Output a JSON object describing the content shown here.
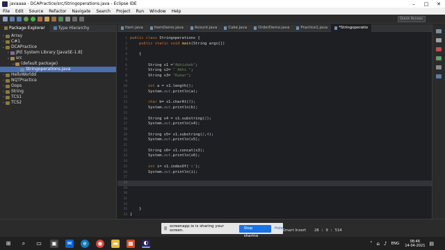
{
  "window": {
    "title": "javaaaa - DCAPractice/src/Stringoperations.java - Eclipse IDE"
  },
  "menu": [
    "File",
    "Edit",
    "Source",
    "Refactor",
    "Navigate",
    "Search",
    "Project",
    "Run",
    "Window",
    "Help"
  ],
  "quick_access": {
    "placeholder": "Quick Access"
  },
  "left_panel": {
    "tabs": [
      "Package Explorer",
      "Type Hierarchy"
    ],
    "tree": [
      {
        "label": "Array",
        "arrow": "›",
        "indent": 0,
        "icon": "project-icon"
      },
      {
        "label": "C#1",
        "arrow": "›",
        "indent": 0,
        "icon": "project-icon"
      },
      {
        "label": "DCAPractice",
        "arrow": "⌄",
        "indent": 0,
        "icon": "project-icon"
      },
      {
        "label": "JRE System Library [JavaSE-1.8]",
        "arrow": "›",
        "indent": 1,
        "icon": "library-icon"
      },
      {
        "label": "src",
        "arrow": "⌄",
        "indent": 1,
        "icon": "source-folder-icon"
      },
      {
        "label": "(default package)",
        "arrow": "⌄",
        "indent": 2,
        "icon": "package-icon"
      },
      {
        "label": "Stringoperations.java",
        "arrow": "›",
        "indent": 3,
        "icon": "java-file-icon",
        "selected": true
      },
      {
        "label": "HelloWorldd",
        "arrow": "›",
        "indent": 0,
        "icon": "project-icon"
      },
      {
        "label": "NQTPractice",
        "arrow": "›",
        "indent": 0,
        "icon": "project-icon"
      },
      {
        "label": "Oops",
        "arrow": "›",
        "indent": 0,
        "icon": "project-icon"
      },
      {
        "label": "String",
        "arrow": "›",
        "indent": 0,
        "icon": "project-icon"
      },
      {
        "label": "TCS1",
        "arrow": "›",
        "indent": 0,
        "icon": "project-icon"
      },
      {
        "label": "TCS2",
        "arrow": "›",
        "indent": 0,
        "icon": "project-icon"
      }
    ]
  },
  "editor": {
    "tabs": [
      "Item.java",
      "ItemDemo.java",
      "Acount.java",
      "Cake.java",
      "OrderDemo.java",
      "Practice1.java",
      "*Stringoperatio"
    ],
    "active_tab": "*Stringoperatio",
    "current_line": 28,
    "lines": [
      {
        "n": 1,
        "html": "<span class='k'>public class</span> <span class='t'>Stringoperations {</span>"
      },
      {
        "n": 2,
        "html": "    <span class='k'>public static void</span> <span class='m'>main</span><span class='t'>(String args[])</span>"
      },
      {
        "n": 3,
        "html": ""
      },
      {
        "n": 4,
        "html": "    <span class='t'>{</span>"
      },
      {
        "n": 5,
        "html": ""
      },
      {
        "n": 6,
        "html": "        <span class='t'>String s1 =</span><span class='s'>\"Abhishek\"</span><span class='t'>;</span>"
      },
      {
        "n": 7,
        "html": "        <span class='t'>String s2= </span><span class='s'>\" Abhi \"</span><span class='t'>;</span>"
      },
      {
        "n": 8,
        "html": "        <span class='t'>String s3= </span><span class='s'>\"Kumar\"</span><span class='t'>;</span>"
      },
      {
        "n": 9,
        "html": ""
      },
      {
        "n": 10,
        "html": "        <span class='k'>int</span> <span class='t'>a = s1.length();</span>"
      },
      {
        "n": 11,
        "html": "        <span class='t'>System.</span><span class='f'>out</span><span class='t'>.println(a);</span>"
      },
      {
        "n": 12,
        "html": ""
      },
      {
        "n": 13,
        "html": "        <span class='k'>char</span> <span class='t'>b= s1.charAt(</span><span class='n'>3</span><span class='t'>);</span>"
      },
      {
        "n": 14,
        "html": "        <span class='t'>System.</span><span class='f'>out</span><span class='t'>.println(b);</span>"
      },
      {
        "n": 15,
        "html": ""
      },
      {
        "n": 16,
        "html": "        <span class='t'>String s4 = s1.substring(</span><span class='n'>2</span><span class='t'>);</span>"
      },
      {
        "n": 17,
        "html": "        <span class='t'>System.</span><span class='f'>out</span><span class='t'>.println(s4);</span>"
      },
      {
        "n": 18,
        "html": ""
      },
      {
        "n": 19,
        "html": "        <span class='t'>String s5= s1.substring(</span><span class='n'>2</span><span class='t'>,</span><span class='n'>4</span><span class='t'>);</span>"
      },
      {
        "n": 20,
        "html": "        <span class='t'>System.</span><span class='f'>out</span><span class='t'>.println(s5);</span>"
      },
      {
        "n": 21,
        "html": ""
      },
      {
        "n": 22,
        "html": "        <span class='t'>String s6= s1.concat(s3);</span>"
      },
      {
        "n": 23,
        "html": "        <span class='t'>System.</span><span class='f'>out</span><span class='t'>.println(s6);</span>"
      },
      {
        "n": 24,
        "html": ""
      },
      {
        "n": 25,
        "html": "        <span class='k'>int</span> <span class='t'>i= s1.indexOf(</span><span class='s'>'s'</span><span class='t'>);</span>"
      },
      {
        "n": 26,
        "html": "        <span class='t'>System.</span><span class='f'>out</span><span class='t'>.println(i);</span>"
      },
      {
        "n": 27,
        "html": ""
      },
      {
        "n": 28,
        "html": ""
      },
      {
        "n": 29,
        "html": ""
      },
      {
        "n": 30,
        "html": ""
      },
      {
        "n": 31,
        "html": ""
      },
      {
        "n": 32,
        "html": ""
      },
      {
        "n": 33,
        "html": "    <span class='t'>}</span>"
      },
      {
        "n": 34,
        "html": "<span class='t'>}</span>"
      }
    ]
  },
  "screen_share": {
    "message": "screenapp.io is sharing your screen.",
    "stop_label": "Stop sharing",
    "hide_label": "Hide"
  },
  "status": {
    "insert_mode": "Smart Insert",
    "cursor_pos": "28 : 9 : 514"
  },
  "taskbar": {
    "language": "ENG",
    "time": "08:46",
    "date": "14-04-2021"
  },
  "colors": {
    "selection": "#4b6eaf",
    "keyword": "#cc7832",
    "string": "#6a8759",
    "stop_button": "#1a73e8"
  }
}
